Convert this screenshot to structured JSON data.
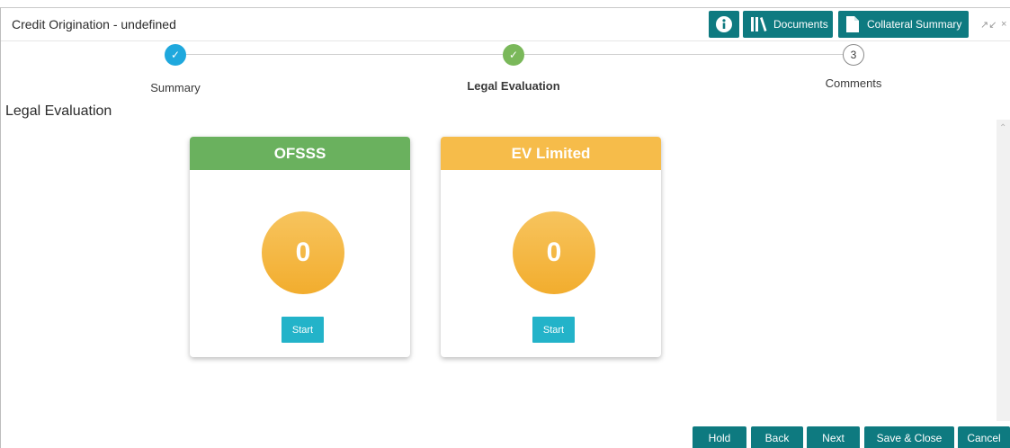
{
  "header": {
    "title": "Credit Origination - undefined",
    "info_icon": "info-icon",
    "documents_label": "Documents",
    "collateral_summary_label": "Collateral Summary"
  },
  "stepper": {
    "steps": [
      {
        "label": "Summary",
        "state": "complete",
        "marker": "✓"
      },
      {
        "label": "Legal Evaluation",
        "state": "current",
        "marker": "✓"
      },
      {
        "label": "Comments",
        "state": "pending",
        "marker": "3"
      }
    ]
  },
  "main": {
    "section_title": "Legal Evaluation",
    "cards": [
      {
        "name": "OFSSS",
        "count": "0",
        "button": "Start",
        "color": "#6ab15e"
      },
      {
        "name": "EV Limited",
        "count": "0",
        "button": "Start",
        "color": "#f6bc4a"
      }
    ]
  },
  "footer": {
    "buttons": [
      "Hold",
      "Back",
      "Next",
      "Save & Close",
      "Cancel"
    ]
  },
  "colors": {
    "accent": "#0e7a80",
    "step_complete": "#1fa8dd",
    "step_current": "#7ab85a",
    "start_button": "#23b3c9"
  }
}
